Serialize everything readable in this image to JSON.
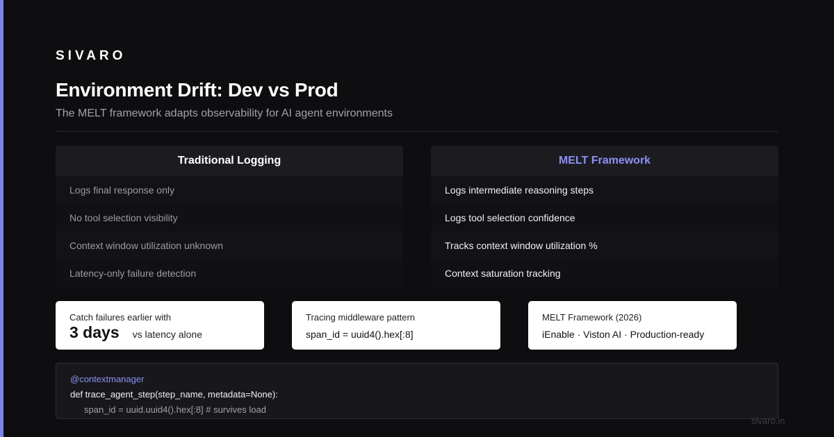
{
  "brand": "SIVARO",
  "title": "Environment Drift: Dev vs Prod",
  "subtitle": "The MELT framework adapts observability for AI agent environments",
  "comparison": {
    "left": {
      "header": "Traditional Logging",
      "items": [
        "Logs final response only",
        "No tool selection visibility",
        "Context window utilization unknown",
        "Latency-only failure detection"
      ]
    },
    "right": {
      "header": "MELT Framework",
      "items": [
        "Logs intermediate reasoning steps",
        "Logs tool selection confidence",
        "Tracks context window utilization %",
        "Context saturation tracking"
      ]
    }
  },
  "cards": [
    {
      "label": "Catch failures earlier with",
      "big": "3 days",
      "note": "vs latency alone"
    },
    {
      "label": "Tracing middleware pattern",
      "value": "span_id = uuid4().hex[:8]"
    },
    {
      "label": "MELT Framework (2026)",
      "value": "iEnable · Viston AI · Production-ready"
    }
  ],
  "code": {
    "line1": "@contextmanager",
    "line2": "def trace_agent_step(step_name, metadata=None):",
    "line3": "span_id = uuid.uuid4().hex[:8] # survives load"
  },
  "footer": "sivaro.in",
  "colors": {
    "accent": "#7b83ec",
    "background": "#0e0e10",
    "melt_header": "#8b91f5"
  }
}
